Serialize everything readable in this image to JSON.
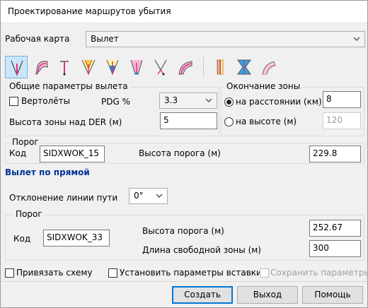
{
  "window": {
    "title": "Проектирование маршрутов убытия"
  },
  "work_map": {
    "label": "Рабочая карта",
    "value": "Вылет"
  },
  "toolbar": {
    "icons": [
      "departure-straight-icon",
      "departure-turn-icon",
      "departure-point-icon",
      "departure-fan-icon",
      "departure-fan-blue-icon",
      "departure-corridor-icon",
      "departure-split-icon",
      "departure-curve-icon",
      "arrival-straight-icon",
      "arrival-funnel-icon",
      "arrival-turn-icon"
    ]
  },
  "general": {
    "title": "Общие параметры вылета",
    "helicopters_label": "Вертолёты",
    "pdg_label": "PDG %",
    "pdg_value": "3.3",
    "zone_height_label": "Высота зоны над DER (м)",
    "zone_height_value": "5"
  },
  "zone_end": {
    "title": "Окончание зоны",
    "distance_label": "на расстоянии (км)",
    "distance_value": "8",
    "height_label": "на высоте (м)",
    "height_value": "120"
  },
  "threshold": {
    "title": "Порог",
    "code_label": "Код",
    "code_value": "SIDXWOK_15",
    "height_label": "Высота порога (м)",
    "height_value": "229.8"
  },
  "straight": {
    "heading": "Вылет по прямой",
    "deviation_label": "Отклонение линии пути",
    "deviation_value": "0°",
    "threshold_title": "Порог",
    "code_label": "Код",
    "code_value": "SIDXWOK_33",
    "height_label": "Высота порога (м)",
    "height_value": "252.67",
    "free_zone_label": "Длина свободной зоны (м)",
    "free_zone_value": "300"
  },
  "options": {
    "bind_scheme": "Привязать схему",
    "set_insert_params": "Установить параметры вставки",
    "save_params": "Сохранить параметры"
  },
  "buttons": {
    "create": "Создать",
    "exit": "Выход",
    "help": "Помощь"
  },
  "colors": {
    "accent": "#0078d7",
    "heading": "#003399",
    "selected_tool": "#cde6f7"
  }
}
